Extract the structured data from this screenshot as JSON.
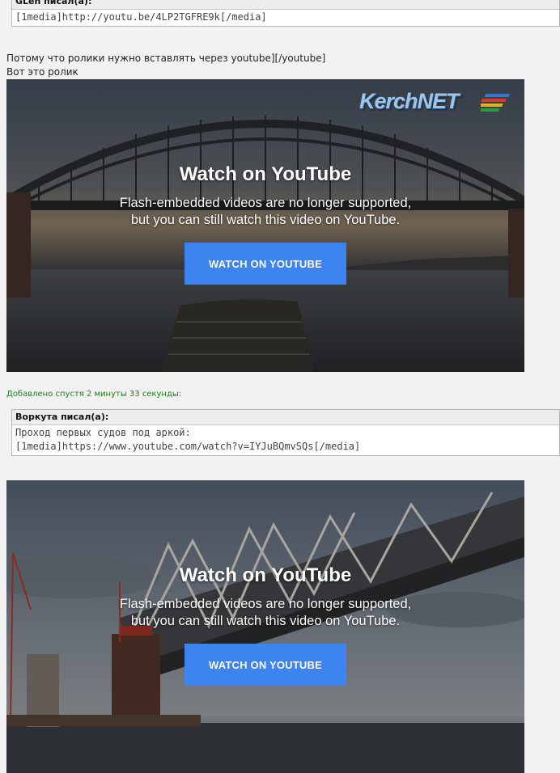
{
  "quote1": {
    "author": "GLen писал(а):",
    "body": "[1media]http://youtu.be/4LP2TGFRE9k[/media]"
  },
  "post": {
    "line1": "Потому что ролики нужно вставлять через youtube][/youtube]",
    "line2": "Вот это ролик"
  },
  "video1": {
    "logo": "KerchNET",
    "title": "Watch on YouTube",
    "message_line1": "Flash-embedded videos are no longer supported,",
    "message_line2": "but you can still watch this video on YouTube.",
    "button": "WATCH ON YOUTUBE"
  },
  "added_note": "Добавлено спустя 2 минуты 33 секунды:",
  "quote2": {
    "author": "Воркута писал(а):",
    "body_line1": "Проход первых судов под аркой:",
    "body_line2": "[1media]https://www.youtube.com/watch?v=IYJuBQmvSQs[/media]"
  },
  "video2": {
    "title": "Watch on YouTube",
    "message_line1": "Flash-embedded videos are no longer supported,",
    "message_line2": "but you can still watch this video on YouTube.",
    "button": "WATCH ON YOUTUBE"
  },
  "colors": {
    "button": "#3d84f0",
    "added_note": "#128512"
  }
}
